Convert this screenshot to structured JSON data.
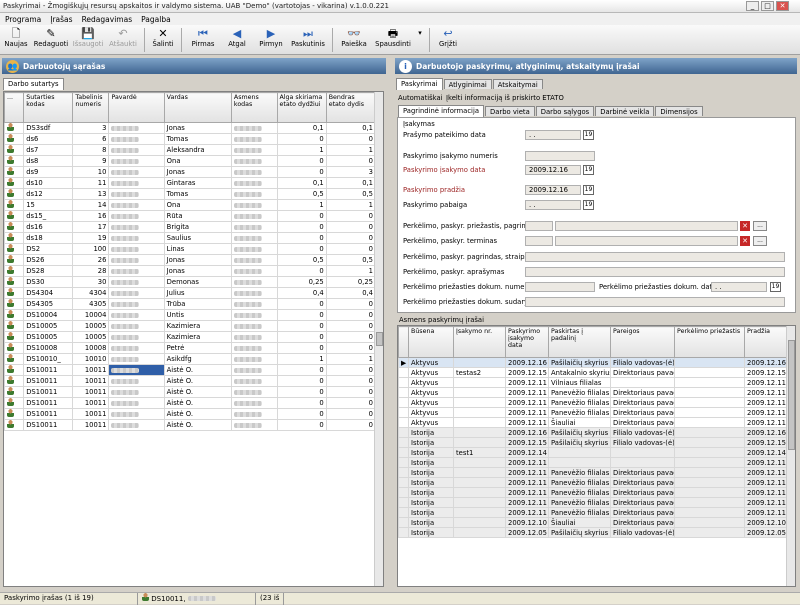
{
  "window": {
    "title": "Paskyrimai - Žmogiškųjų resursų apskaitos ir valdymo sistema. UAB \"Demo\" (vartotojas - vikarina) v.1.0.0.221"
  },
  "menu": [
    "Programa",
    "Įrašas",
    "Redagavimas",
    "Pagalba"
  ],
  "toolbar": {
    "new": "Naujas",
    "edit": "Redaguoti",
    "save": "Išsaugoti",
    "cancel": "Atšaukti",
    "delete": "Šalinti",
    "first": "Pirmas",
    "prev": "Atgal",
    "next": "Pirmyn",
    "last": "Paskutinis",
    "search": "Paieška",
    "print": "Spausdinti",
    "back": "Grįžti"
  },
  "left": {
    "header": "Darbuotojų sąrašas",
    "tab": "Darbo sutartys",
    "columns": [
      "...",
      "Sutarties kodas",
      "Tabelinis numeris",
      "Pavardė",
      "Vardas",
      "Asmens kodas",
      "Alga skiriama etato dydžiui",
      "Bendras etato dydis"
    ],
    "rows": [
      [
        "DS3sdf",
        "3",
        "Jonas",
        "0,1",
        "0,1"
      ],
      [
        "ds6",
        "6",
        "Tomas",
        "0",
        "0"
      ],
      [
        "ds7",
        "8",
        "Aleksandra",
        "1",
        "1"
      ],
      [
        "ds8",
        "9",
        "Ona",
        "0",
        "0"
      ],
      [
        "ds9",
        "10",
        "Jonas",
        "0",
        "3"
      ],
      [
        "ds10",
        "11",
        "Gintaras",
        "0,1",
        "0,1"
      ],
      [
        "ds12",
        "13",
        "Tomas",
        "0,5",
        "0,5"
      ],
      [
        "15",
        "14",
        "Ona",
        "1",
        "1"
      ],
      [
        "ds15_",
        "16",
        "Rūta",
        "0",
        "0"
      ],
      [
        "ds16",
        "17",
        "Brigita",
        "0",
        "0"
      ],
      [
        "ds18",
        "19",
        "Saulius",
        "0",
        "0"
      ],
      [
        "DS2",
        "100",
        "Linas",
        "0",
        "0"
      ],
      [
        "DS26",
        "26",
        "Jonas",
        "0,5",
        "0,5"
      ],
      [
        "DS28",
        "28",
        "Jonas",
        "0",
        "1"
      ],
      [
        "DS30",
        "30",
        "Demonas",
        "0,25",
        "0,25"
      ],
      [
        "DS4304",
        "4304",
        "Julius",
        "0,4",
        "0,4"
      ],
      [
        "DS4305",
        "4305",
        "Trūba",
        "0",
        "0"
      ],
      [
        "DS10004",
        "10004",
        "Untis",
        "0",
        "0"
      ],
      [
        "DS10005",
        "10005",
        "Kazimiera",
        "0",
        "0"
      ],
      [
        "DS10005",
        "10005",
        "Kazimiera",
        "0",
        "0"
      ],
      [
        "DS10008",
        "10008",
        "Petrė",
        "0",
        "0"
      ],
      [
        "DS10010_",
        "10010",
        "Asikdfg",
        "1",
        "1"
      ],
      [
        "DS10011",
        "10011",
        "Aistė O.",
        "0",
        "0"
      ],
      [
        "DS10011",
        "10011",
        "Aistė O.",
        "0",
        "0"
      ],
      [
        "DS10011",
        "10011",
        "Aistė O.",
        "0",
        "0"
      ],
      [
        "DS10011",
        "10011",
        "Aistė O.",
        "0",
        "0"
      ],
      [
        "DS10011",
        "10011",
        "Aistė O.",
        "0",
        "0"
      ],
      [
        "DS10011",
        "10011",
        "Aistė O.",
        "0",
        "0"
      ]
    ]
  },
  "right": {
    "header": "Darbuotojo paskyrimų, atlyginimų, atskaitymų įrašai",
    "tabs": [
      "Paskyrimai",
      "Atlyginimai",
      "Atskaitymai"
    ],
    "links": [
      "Automatiškai",
      "Įkelti informaciją iš priskirto ETATO"
    ],
    "subtabs": [
      "Pagrindinė informacija",
      "Darbo vieta",
      "Darbo sąlygos",
      "Darbinė veikla",
      "Dimensijos"
    ],
    "form": {
      "section": "Įsakymas",
      "request_date": "Prašymo pateikimo data",
      "order_no": "Paskyrimo įsakymo numeris",
      "order_date": "Paskyrimo įsakymo data",
      "order_date_val": "2009.12.16",
      "start": "Paskyrimo pradžia",
      "start_val": "2009.12.16",
      "end": "Paskyrimo pabaiga",
      "empty_date": ". .",
      "move_reason": "Perkėlimo, paskyr. priežastis, pagrindas",
      "move_term": "Perkėlimo, paskyr. terminas",
      "move_basis": "Perkėlimo, paskyr. pagrindas, straipsnis",
      "move_desc": "Perkėlimo, paskyr. aprašymas",
      "doc_no": "Perkėlimo priežasties dokum. numeris",
      "doc_date": "Perkėlimo priežasties dokum. data",
      "doc_made": "Perkėlimo priežasties dokum. sudarytojas"
    },
    "orders_section": "Asmens paskyrimų įrašai",
    "columns": [
      "Būsena",
      "Įsakymo nr.",
      "Paskyrimo įsakymo data",
      "Paskirtas į padalinį",
      "Pareigos",
      "Perkėlimo priežastis",
      "Pradžia"
    ],
    "rows": [
      [
        "Aktyvus",
        "",
        "2009.12.16",
        "Pašilaičių skyrius",
        "Filialo vadovas-(ė)",
        "",
        "2009.12.16"
      ],
      [
        "Aktyvus",
        "testas2",
        "2009.12.15",
        "Antakalnio skyrius",
        "Direktoriaus pavadu",
        "",
        "2009.12.15"
      ],
      [
        "Aktyvus",
        "",
        "2009.12.11",
        "Vilniaus filialas",
        "",
        "",
        "2009.12.11"
      ],
      [
        "Aktyvus",
        "",
        "2009.12.11",
        "Panevėžio filialas",
        "Direktoriaus pavadu",
        "",
        "2009.12.11"
      ],
      [
        "Aktyvus",
        "",
        "2009.12.11",
        "Panevėžio filialas",
        "Direktoriaus pavadu",
        "",
        "2009.12.11"
      ],
      [
        "Aktyvus",
        "",
        "2009.12.11",
        "Panevėžio filialas",
        "Direktoriaus pavadu",
        "",
        "2009.12.11"
      ],
      [
        "Aktyvus",
        "",
        "2009.12.11",
        "Šiauliai",
        "Direktoriaus pavadu",
        "",
        "2009.12.11"
      ],
      [
        "Istorija",
        "",
        "2009.12.16",
        "Pašilaičių skyrius",
        "Filialo vadovas-(ė)",
        "",
        "2009.12.16"
      ],
      [
        "Istorija",
        "",
        "2009.12.15",
        "Pašilaičių skyrius",
        "Filialo vadovas-(ė)",
        "",
        "2009.12.15"
      ],
      [
        "Istorija",
        "test1",
        "2009.12.14",
        "",
        "",
        "",
        "2009.12.14"
      ],
      [
        "Istorija",
        "",
        "2009.12.11",
        "",
        "",
        "",
        "2009.12.11"
      ],
      [
        "Istorija",
        "",
        "2009.12.11",
        "Panevėžio filialas",
        "Direktoriaus pavadu",
        "",
        "2009.12.11"
      ],
      [
        "Istorija",
        "",
        "2009.12.11",
        "Panevėžio filialas",
        "Direktoriaus pavadu",
        "",
        "2009.12.11"
      ],
      [
        "Istorija",
        "",
        "2009.12.11",
        "Panevėžio filialas",
        "Direktoriaus pavadu",
        "",
        "2009.12.11"
      ],
      [
        "Istorija",
        "",
        "2009.12.11",
        "Panevėžio filialas",
        "Direktoriaus pavadu",
        "",
        "2009.12.11"
      ],
      [
        "Istorija",
        "",
        "2009.12.11",
        "Panevėžio filialas",
        "Direktoriaus pavadu",
        "",
        "2009.12.11"
      ],
      [
        "Istorija",
        "",
        "2009.12.10",
        "Šiauliai",
        "Direktoriaus pavadu",
        "",
        "2009.12.10"
      ],
      [
        "Istorija",
        "",
        "2009.12.05",
        "Pašilaičių skyrius",
        "Filialo vadovas-(ė)",
        "",
        "2009.12.05"
      ]
    ]
  },
  "status": {
    "records": "Paskyrimo įrašas (1 iš 19)",
    "employee": "DS10011,",
    "count": "(23 iš"
  }
}
